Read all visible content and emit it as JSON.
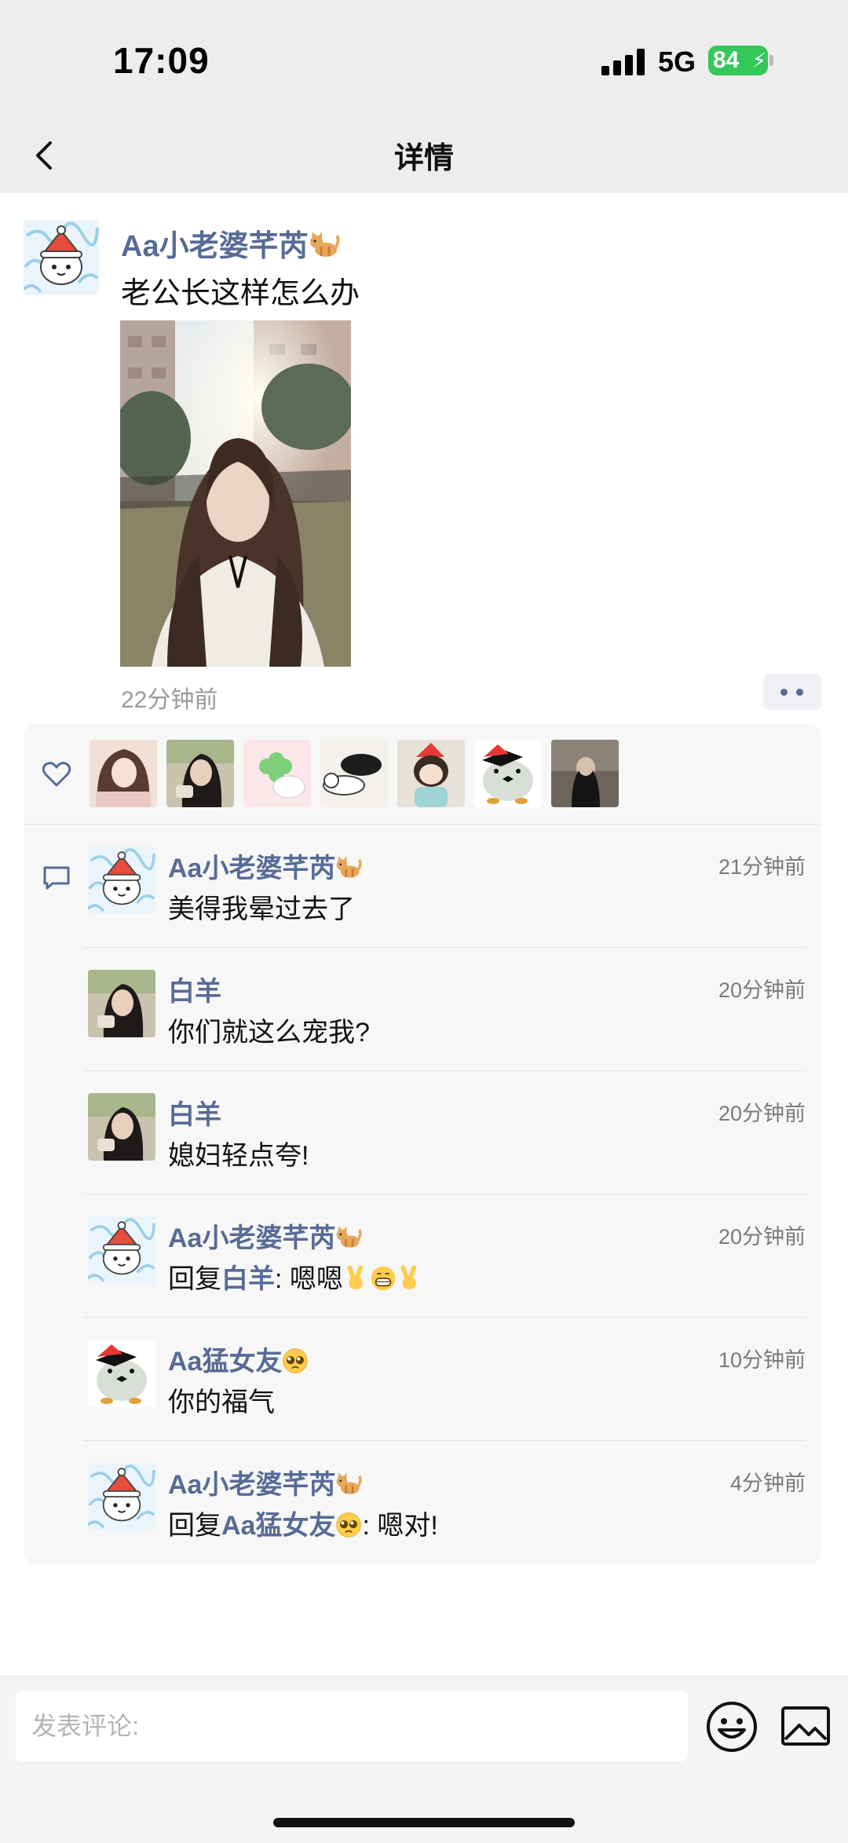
{
  "status_bar": {
    "time": "17:09",
    "network": "5G",
    "battery": "84"
  },
  "nav": {
    "title": "详情"
  },
  "post": {
    "author": "Aa小老婆芊芮",
    "author_emoji": "cat-emoji",
    "text": "老公长这样怎么办",
    "time": "22分钟前"
  },
  "likes": {
    "avatars": [
      "avatar-girl-1",
      "avatar-baiyang",
      "avatar-clover",
      "avatar-dogs",
      "avatar-cartoon-girl",
      "avatar-penguin",
      "avatar-girl-street"
    ]
  },
  "comments": [
    {
      "author": "Aa小老婆芊芮",
      "emoji": "cat-emoji",
      "time": "21分钟前",
      "text": "美得我晕过去了",
      "avatar": "cat-cartoon"
    },
    {
      "author": "白羊",
      "time": "20分钟前",
      "text": "你们就这么宠我?",
      "avatar": "girl-dark-hair"
    },
    {
      "author": "白羊",
      "time": "20分钟前",
      "text": "媳妇轻点夸!",
      "avatar": "girl-dark-hair"
    },
    {
      "author": "Aa小老婆芊芮",
      "emoji": "cat-emoji",
      "time": "20分钟前",
      "reply_prefix": "回复",
      "reply_to": "白羊",
      "text": ": 嗯嗯",
      "avatar": "cat-cartoon"
    },
    {
      "author": "Aa猛女友",
      "emoji": "pleading-face-emoji",
      "time": "10分钟前",
      "text": "你的福气",
      "avatar": "penguin-cartoon"
    },
    {
      "author": "Aa小老婆芊芮",
      "emoji": "cat-emoji",
      "time": "4分钟前",
      "reply_prefix": "回复",
      "reply_to": "Aa猛女友",
      "text": ": 嗯对!",
      "avatar": "cat-cartoon"
    }
  ],
  "input": {
    "placeholder": "发表评论:"
  },
  "colors": {
    "link": "#576b95",
    "panel": "#f7f7f7",
    "battery": "#34c759"
  }
}
